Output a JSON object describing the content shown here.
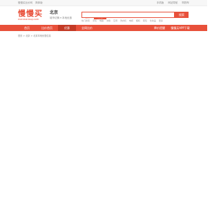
{
  "topbar": {
    "left_links": [
      "慢慢买比价网",
      "简体版"
    ],
    "right_links": [
      "手机版",
      "网站导航",
      "购物车"
    ]
  },
  "logo": {
    "text": "慢慢买",
    "domain": "manmanbuy.com"
  },
  "city": {
    "name": "北京",
    "subtitle": "城市切换 ▾ 本地优惠"
  },
  "search": {
    "tabs": [
      "比价",
      "商城"
    ],
    "placeholder": "",
    "button": "搜索",
    "hot": [
      "热门搜索",
      "手机",
      "电脑",
      "冰箱",
      "空调",
      "洗衣机",
      "电视",
      "相机",
      "鞋包",
      "化妆品",
      "更多"
    ]
  },
  "nav": {
    "items": [
      "首页",
      "比价首页",
      "优惠",
      "全网比价"
    ],
    "right_items": [
      "降价提醒",
      "慢慢买APP下载"
    ]
  },
  "breadcrumb": "首页 > 北京 > 北京本地优惠信息"
}
